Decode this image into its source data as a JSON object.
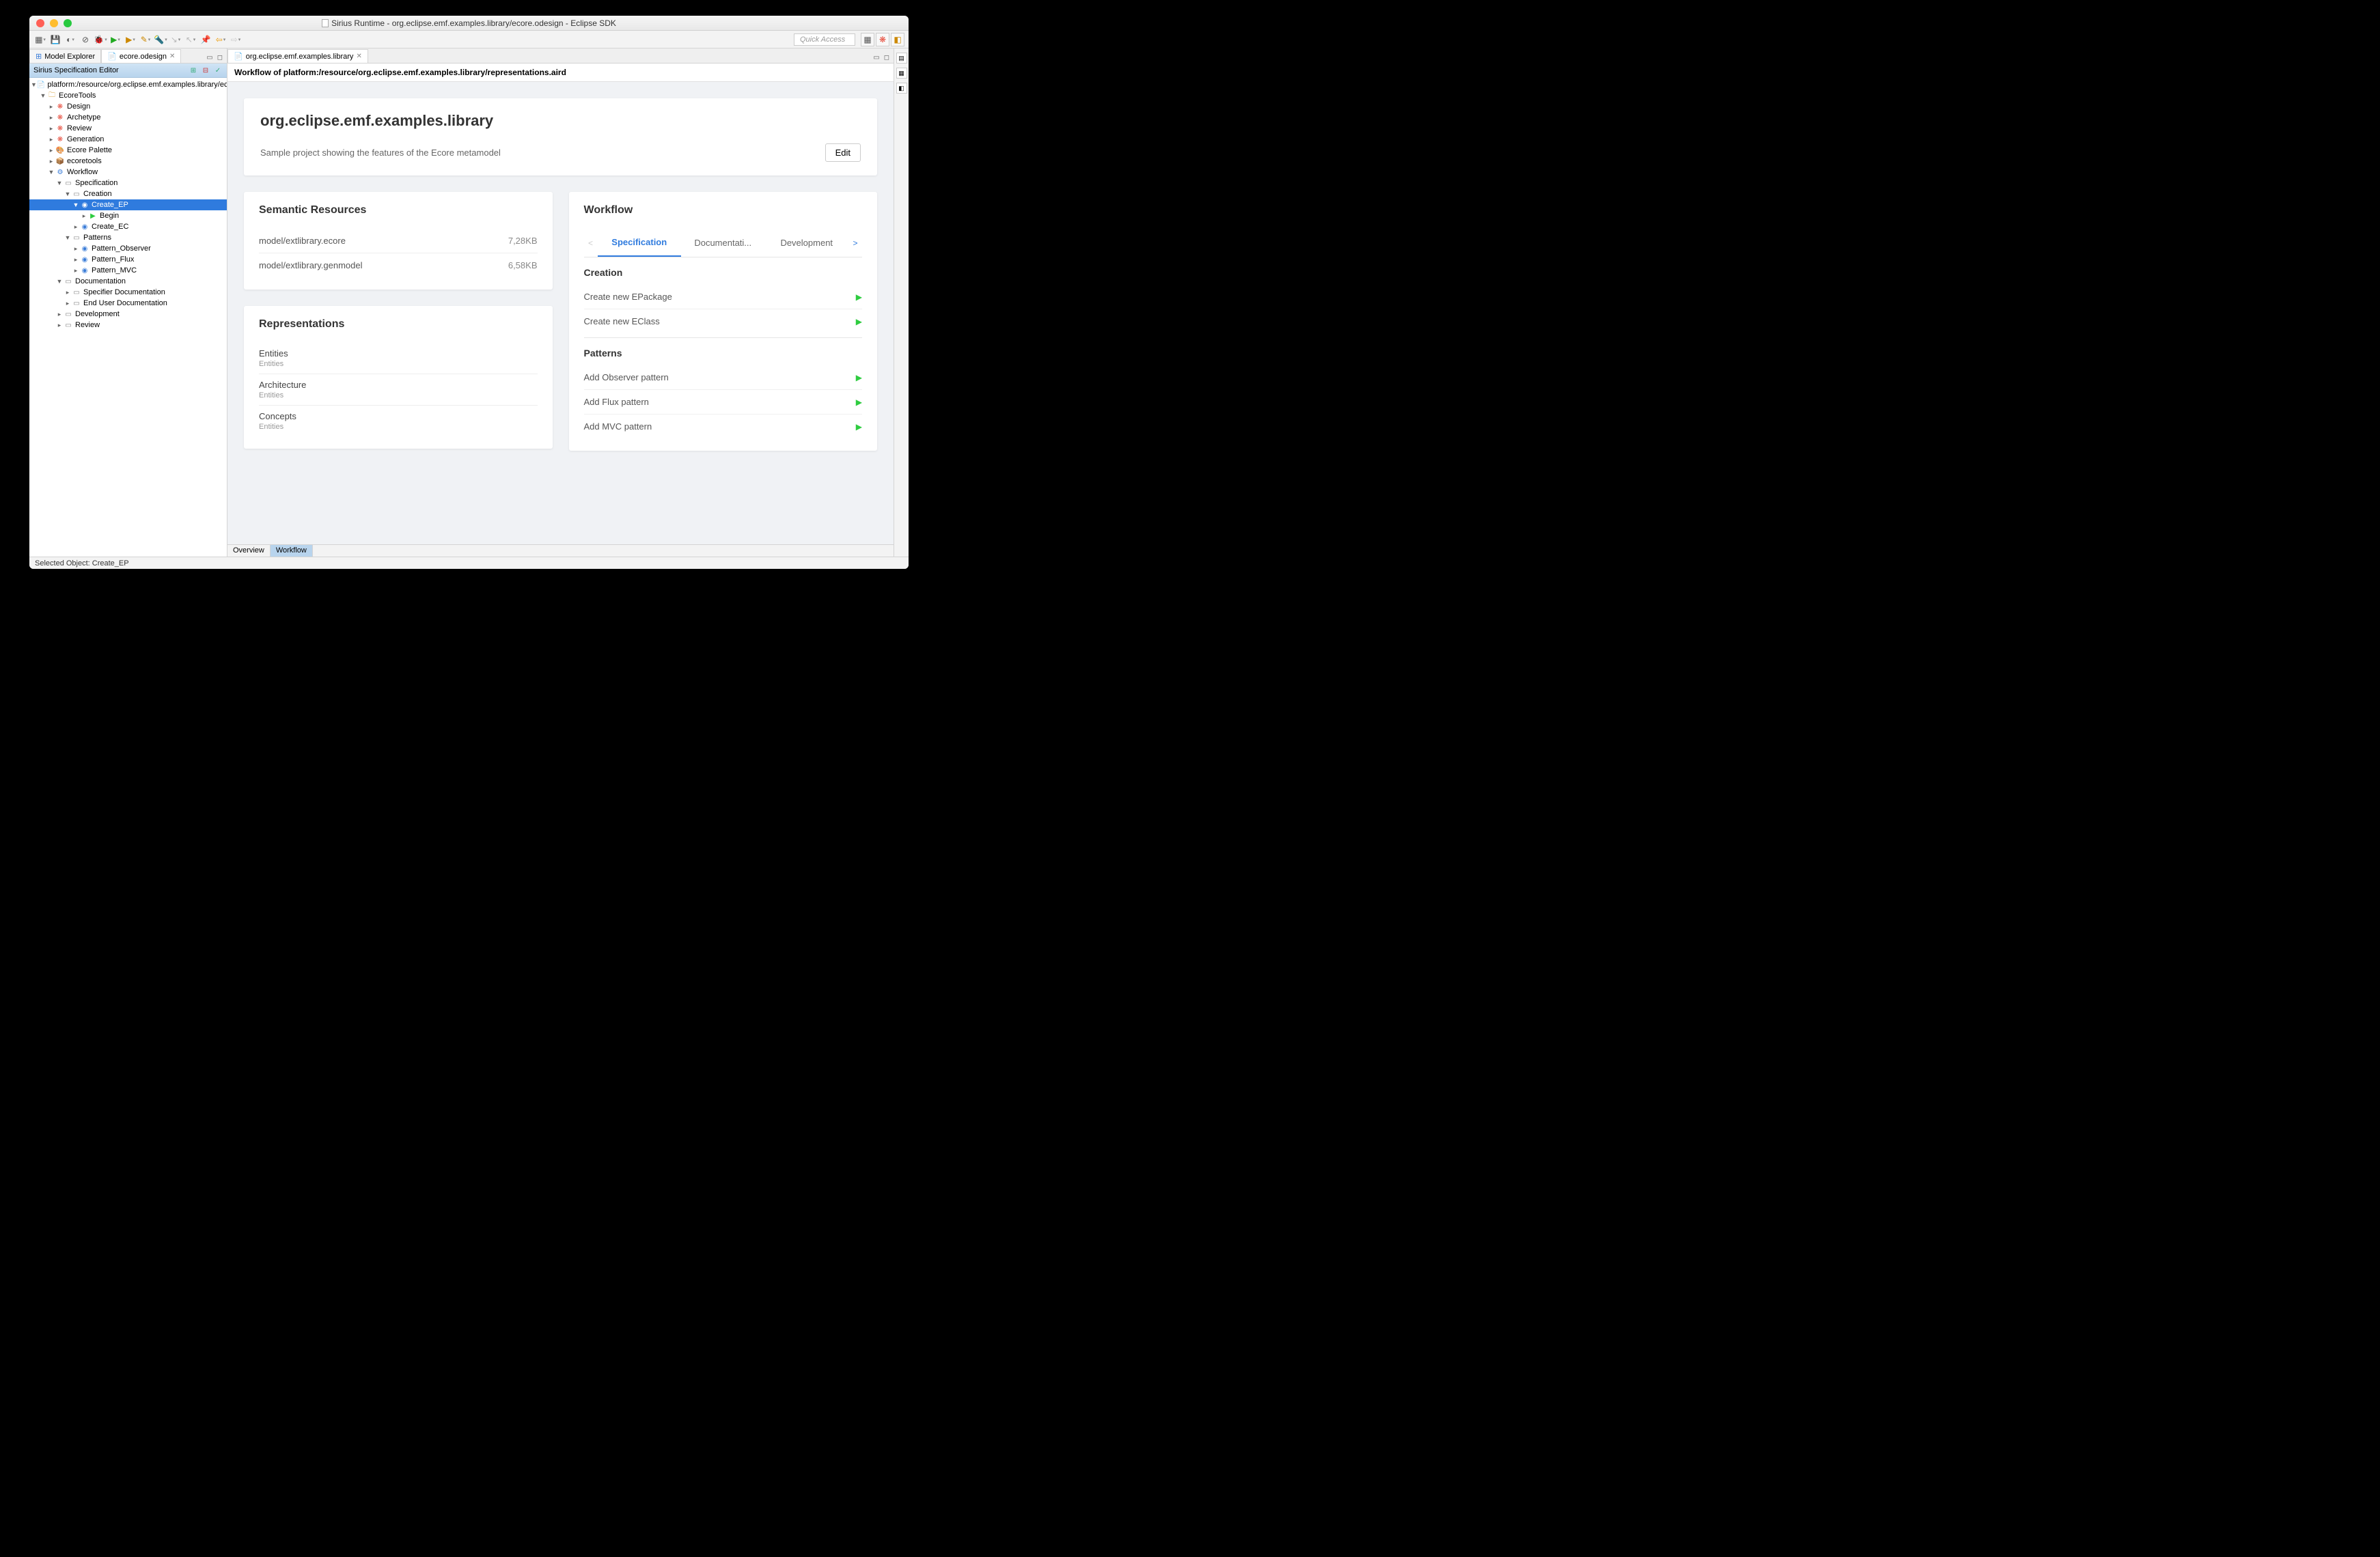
{
  "window_title": "Sirius Runtime - org.eclipse.emf.examples.library/ecore.odesign - Eclipse SDK",
  "quick_access": "Quick Access",
  "left_tabs": {
    "explorer": "Model Explorer",
    "odesign": "ecore.odesign"
  },
  "sirius_header": "Sirius Specification Editor",
  "tree": {
    "root": "platform:/resource/org.eclipse.emf.examples.library/ecore.odesign",
    "ecoretools": "EcoreTools",
    "design": "Design",
    "archetype": "Archetype",
    "review": "Review",
    "generation": "Generation",
    "palette": "Ecore Palette",
    "ecoretools2": "ecoretools",
    "workflow": "Workflow",
    "specification": "Specification",
    "creation": "Creation",
    "create_ep": "Create_EP",
    "begin": "Begin",
    "create_ec": "Create_EC",
    "patterns": "Patterns",
    "p_obs": "Pattern_Observer",
    "p_flux": "Pattern_Flux",
    "p_mvc": "Pattern_MVC",
    "documentation": "Documentation",
    "spec_doc": "Specifier Documentation",
    "user_doc": "End User Documentation",
    "development": "Development",
    "review2": "Review"
  },
  "editor_tab": "org.eclipse.emf.examples.library",
  "editor_heading": "Workflow of platform:/resource/org.eclipse.emf.examples.library/representations.aird",
  "hero": {
    "title": "org.eclipse.emf.examples.library",
    "desc": "Sample project showing the features of the Ecore metamodel",
    "edit": "Edit"
  },
  "semantic": {
    "title": "Semantic Resources",
    "rows": [
      {
        "name": "model/extlibrary.ecore",
        "size": "7,28KB"
      },
      {
        "name": "model/extlibrary.genmodel",
        "size": "6,58KB"
      }
    ]
  },
  "representations": {
    "title": "Representations",
    "rows": [
      {
        "name": "Entities",
        "sub": "Entities"
      },
      {
        "name": "Architecture",
        "sub": "Entities"
      },
      {
        "name": "Concepts",
        "sub": "Entities"
      }
    ]
  },
  "workflow": {
    "title": "Workflow",
    "tabs": {
      "spec": "Specification",
      "doc": "Documentati...",
      "dev": "Development"
    },
    "sec_creation": "Creation",
    "creation_items": [
      "Create new EPackage",
      "Create new EClass"
    ],
    "sec_patterns": "Patterns",
    "pattern_items": [
      "Add Observer pattern",
      "Add Flux pattern",
      "Add MVC pattern"
    ]
  },
  "bottom_tabs": {
    "overview": "Overview",
    "workflow": "Workflow"
  },
  "status": "Selected Object: Create_EP"
}
